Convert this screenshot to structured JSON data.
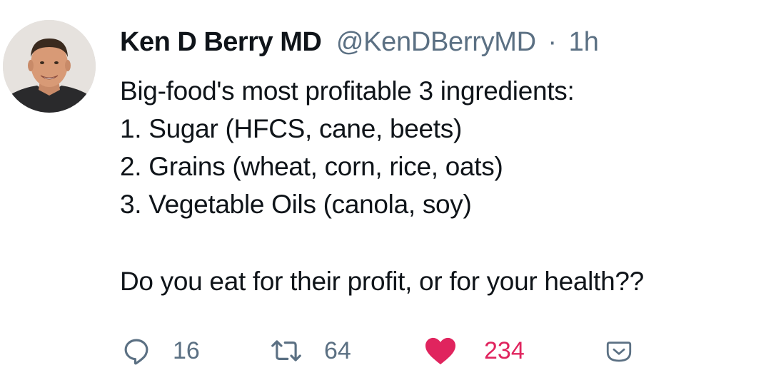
{
  "tweet": {
    "display_name": "Ken D Berry MD",
    "handle": "@KenDBerryMD",
    "separator": "·",
    "time": "1h",
    "lines": [
      "Big-food's most profitable 3 ingredients:",
      "1. Sugar (HFCS, cane, beets)",
      "2. Grains (wheat, corn, rice, oats)",
      "3. Vegetable Oils (canola, soy)"
    ],
    "closing": "Do you eat for their profit, or for your health??"
  },
  "actions": {
    "reply": {
      "icon": "reply-icon",
      "count": "16"
    },
    "retweet": {
      "icon": "retweet-icon",
      "count": "64"
    },
    "like": {
      "icon": "heart-icon",
      "count": "234",
      "liked": true
    },
    "share": {
      "icon": "chevron-down-icon"
    }
  },
  "colors": {
    "text": "#0f1419",
    "secondary": "#5b7083",
    "like": "#e0245e"
  }
}
